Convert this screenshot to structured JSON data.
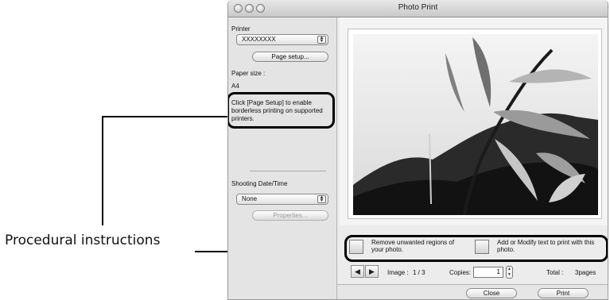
{
  "annotation": {
    "label": "Procedural instructions"
  },
  "window": {
    "title": "Photo Print"
  },
  "sidebar": {
    "printer_label": "Printer",
    "printer_value": "XXXXXXXX",
    "page_setup_label": "Page setup...",
    "paper_size_label": "Paper size :",
    "paper_size_value": "A4",
    "hint": "Click [Page Setup] to enable borderless printing on supported printers.",
    "shooting_label": "Shooting Date/Time",
    "shooting_value": "None",
    "properties_label": "Properties..."
  },
  "tools": {
    "trim_text": "Remove unwanted regions of your photo.",
    "text_text": "Add or Modify text to print with this photo."
  },
  "nav": {
    "image_label": "Image :",
    "image_value": "1 / 3",
    "copies_label": "Copies:",
    "copies_value": "1",
    "total_label": "Total :",
    "total_value": "3pages"
  },
  "footer": {
    "close_label": "Close",
    "print_label": "Print"
  },
  "icons": [
    "prev-arrow-icon",
    "next-arrow-icon",
    "trim-icon",
    "text-icon"
  ]
}
